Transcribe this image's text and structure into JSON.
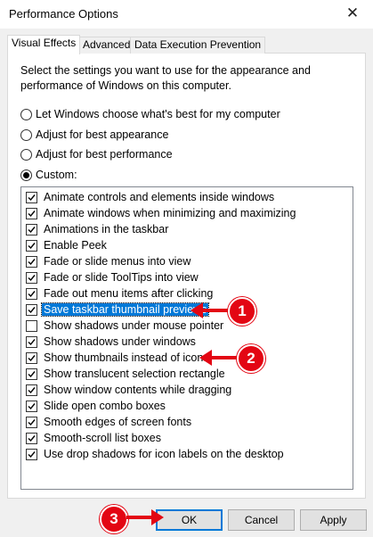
{
  "window": {
    "title": "Performance Options",
    "close_glyph": "✕"
  },
  "tabs": [
    {
      "label": "Visual Effects"
    },
    {
      "label": "Advanced"
    },
    {
      "label": "Data Execution Prevention"
    }
  ],
  "intro_text": "Select the settings you want to use for the appearance and performance of Windows on this computer.",
  "radio_options": [
    {
      "label": "Let Windows choose what's best for my computer",
      "selected": false
    },
    {
      "label": "Adjust for best appearance",
      "selected": false
    },
    {
      "label": "Adjust for best performance",
      "selected": false
    },
    {
      "label": "Custom:",
      "selected": true
    }
  ],
  "settings": [
    {
      "label": "Animate controls and elements inside windows",
      "checked": true
    },
    {
      "label": "Animate windows when minimizing and maximizing",
      "checked": true
    },
    {
      "label": "Animations in the taskbar",
      "checked": true
    },
    {
      "label": "Enable Peek",
      "checked": true
    },
    {
      "label": "Fade or slide menus into view",
      "checked": true
    },
    {
      "label": "Fade or slide ToolTips into view",
      "checked": true
    },
    {
      "label": "Fade out menu items after clicking",
      "checked": true
    },
    {
      "label": "Save taskbar thumbnail previews",
      "checked": true,
      "selected": true
    },
    {
      "label": "Show shadows under mouse pointer",
      "checked": false
    },
    {
      "label": "Show shadows under windows",
      "checked": true
    },
    {
      "label": "Show thumbnails instead of icons",
      "checked": true
    },
    {
      "label": "Show translucent selection rectangle",
      "checked": true
    },
    {
      "label": "Show window contents while dragging",
      "checked": true
    },
    {
      "label": "Slide open combo boxes",
      "checked": true
    },
    {
      "label": "Smooth edges of screen fonts",
      "checked": true
    },
    {
      "label": "Smooth-scroll list boxes",
      "checked": true
    },
    {
      "label": "Use drop shadows for icon labels on the desktop",
      "checked": true
    }
  ],
  "buttons": {
    "ok": "OK",
    "cancel": "Cancel",
    "apply": "Apply"
  },
  "annotations": [
    {
      "number": "1",
      "target": "Save taskbar thumbnail previews"
    },
    {
      "number": "2",
      "target": "Show thumbnails instead of icons"
    },
    {
      "number": "3",
      "target": "OK"
    }
  ],
  "colors": {
    "annotation": "#e30613",
    "selection": "#0078d7",
    "default_button_border": "#0078d7"
  },
  "icons": {
    "close": "close-icon",
    "check": "checkmark-icon",
    "arrow": "arrow-left-icon"
  }
}
